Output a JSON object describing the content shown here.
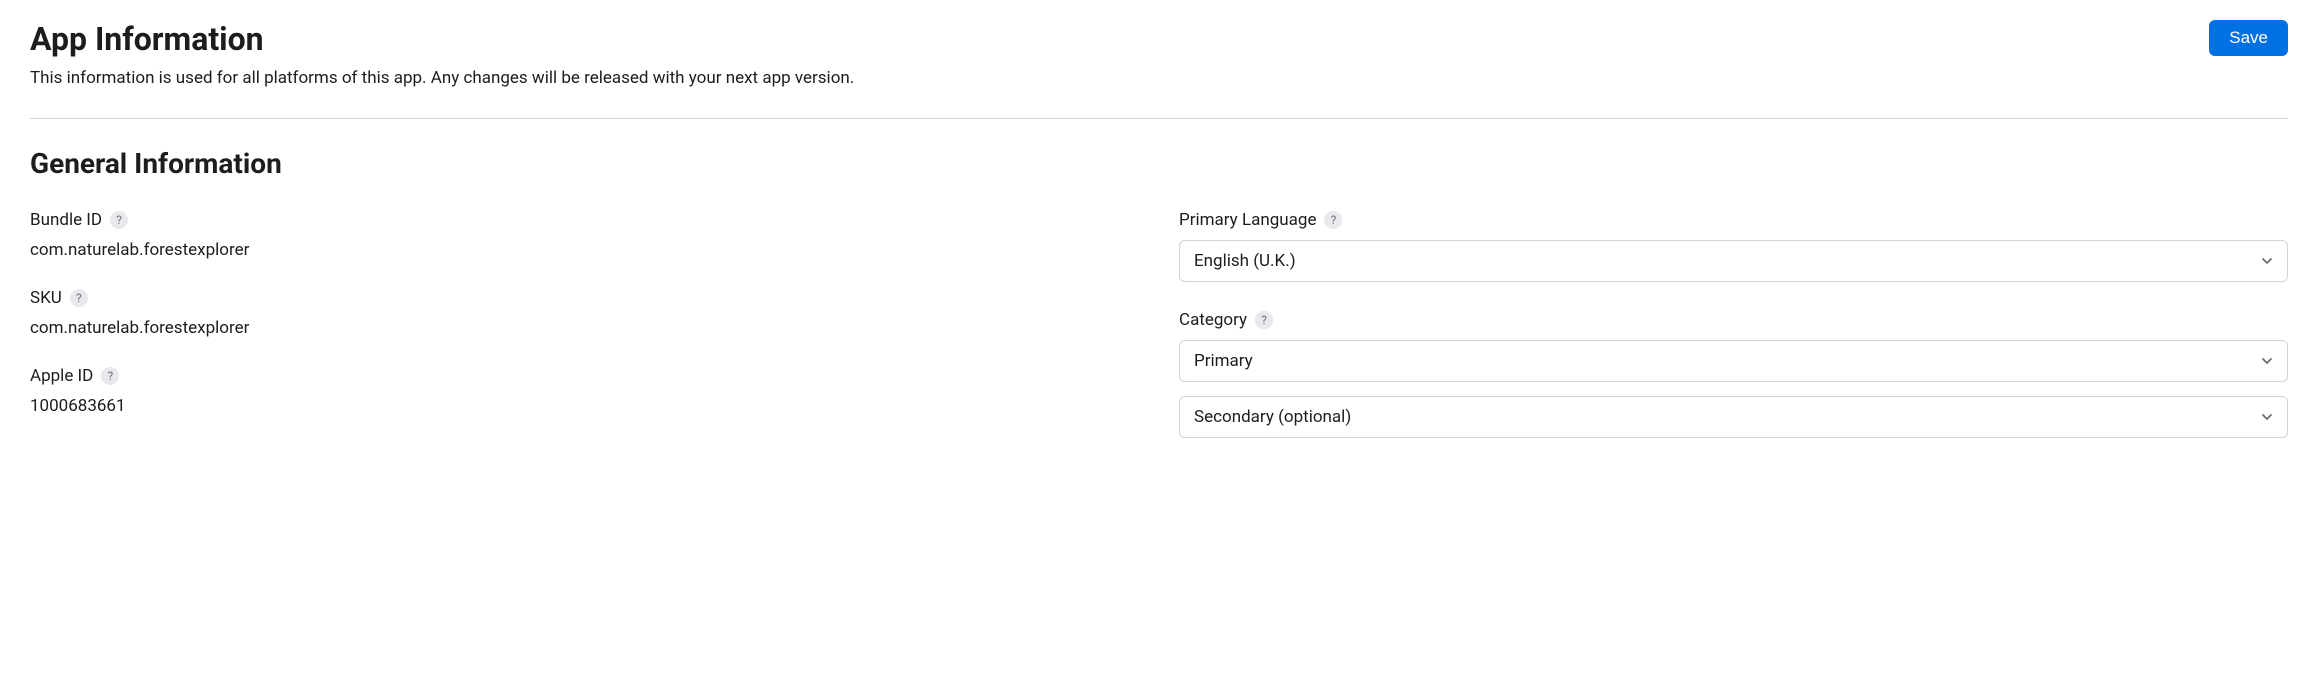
{
  "header": {
    "title": "App Information",
    "subtitle": "This information is used for all platforms of this app. Any changes will be released with your next app version.",
    "save_label": "Save"
  },
  "section": {
    "title": "General Information"
  },
  "fields": {
    "bundle_id": {
      "label": "Bundle ID",
      "value": "com.naturelab.forestexplorer"
    },
    "sku": {
      "label": "SKU",
      "value": "com.naturelab.forestexplorer"
    },
    "apple_id": {
      "label": "Apple ID",
      "value": "1000683661"
    },
    "primary_language": {
      "label": "Primary Language",
      "value": "English (U.K.)"
    },
    "category": {
      "label": "Category",
      "primary_value": "Primary",
      "secondary_value": "Secondary (optional)"
    }
  },
  "help_glyph": "?"
}
